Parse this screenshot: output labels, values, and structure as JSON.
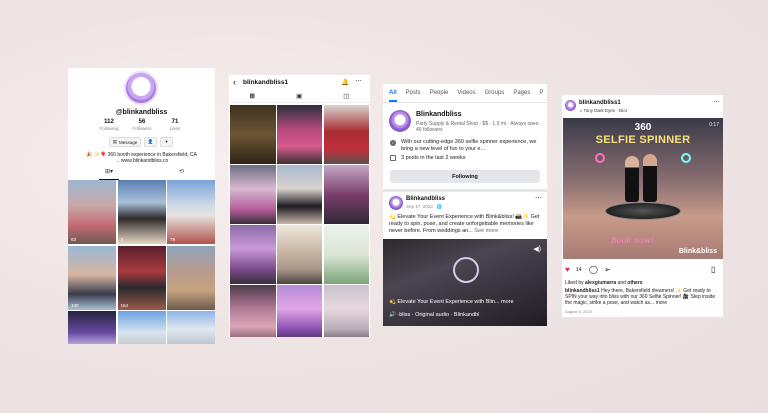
{
  "panel1": {
    "handle": "@blinkandbliss",
    "stats": [
      {
        "value": "112",
        "label": "Following"
      },
      {
        "value": "56",
        "label": "Followers"
      },
      {
        "value": "71",
        "label": "Likes"
      }
    ],
    "message_label": "Message",
    "bio_line1": "🎉 ✨🎈 360 booth experience in Bakersfield, CA",
    "bio_line2": "→ www.blinkandbliss.co",
    "views": [
      "83",
      "3",
      "79",
      "100",
      "164"
    ]
  },
  "panel2": {
    "title": "blinkandbliss1"
  },
  "panel3": {
    "tabs": [
      "All",
      "Posts",
      "People",
      "Videos",
      "Groups",
      "Pages",
      "P"
    ],
    "page_name": "Blinkandbliss",
    "page_meta": "Party Supply & Rental Shop · $$ · 1.9 mi · Always open · 49 followers",
    "info_text": "With our cutting-edge 360 selfie spinner experience, we bring a new level of fun to your e...",
    "posts_text": "3 posts in the last 2 weeks",
    "following_label": "Following",
    "post": {
      "name": "Blinkandbliss",
      "date": "Sep 17, 2023 · 🌐",
      "text": "💫 Elevate Your Event Experience with Blink&bliss! 📸✨ Get ready to spin, pose, and create unforgettable memories like never before. From weddings an...",
      "see_more": "See more",
      "video_caption": "💫 Elevate Your Event Experience with Blin... more",
      "audio": "🔊 ·bliss · Original audio · Blinkandbl"
    }
  },
  "panel4": {
    "username": "blinkandbliss1",
    "song": "♫ Tony Dark Eyes · Dior",
    "image_title1": "360",
    "image_title2": "SELFIE SPINNER",
    "counter": "0:17",
    "book_text": "Book now!",
    "brand": "Blink&bliss",
    "likes": "14",
    "liked_by_prefix": "Liked by ",
    "liked_by_user": "alexgiumarra",
    "liked_by_suffix": " and ",
    "liked_by_others": "others",
    "caption_user": "blinkandbliss1",
    "caption": " Hey there, Bakersfield dreamers! ✨ Get ready to SPIN your way into bliss with our 360 Selfie Spinner! 🎥 Step inside the magic, strike a pose, and watch as... more",
    "date": "August 5, 2023"
  }
}
